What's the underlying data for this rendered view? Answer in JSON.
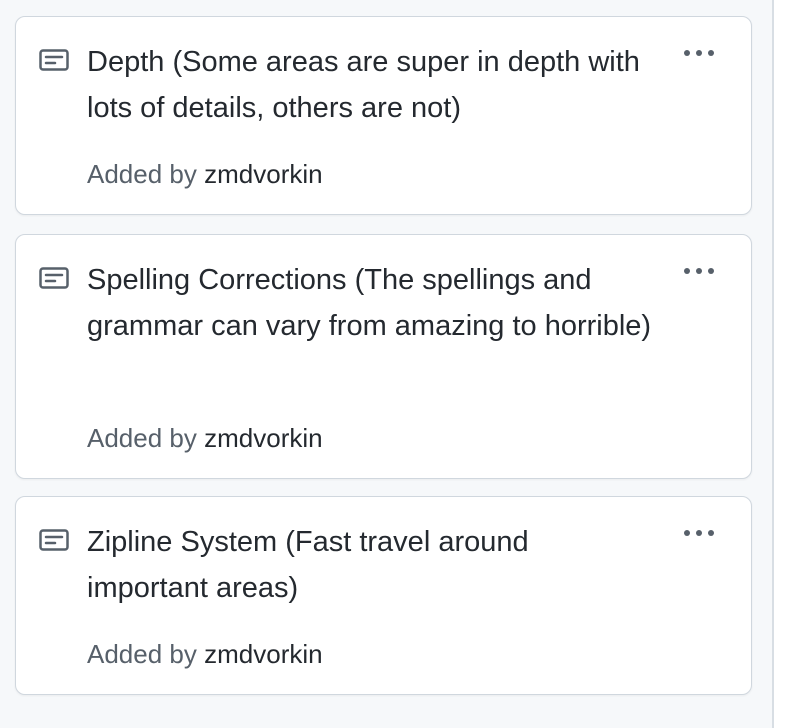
{
  "column": {
    "cards": [
      {
        "icon": "note-icon",
        "title": "Depth (Some areas are super in depth with lots of details, others are not)",
        "added_by_label": "Added by",
        "author": "zmdvorkin",
        "menu_icon": "kebab-horizontal-icon"
      },
      {
        "icon": "note-icon",
        "title": "Spelling Corrections (The spellings and grammar can vary from amazing to horrible)",
        "added_by_label": "Added by",
        "author": "zmdvorkin",
        "menu_icon": "kebab-horizontal-icon"
      },
      {
        "icon": "note-icon",
        "title": "Zipline System (Fast travel around important areas)",
        "added_by_label": "Added by",
        "author": "zmdvorkin",
        "menu_icon": "kebab-horizontal-icon"
      }
    ]
  },
  "colors": {
    "background": "#f6f8fa",
    "card_background": "#ffffff",
    "card_border": "#d0d7de",
    "text_primary": "#24292f",
    "text_muted": "#57606a"
  }
}
